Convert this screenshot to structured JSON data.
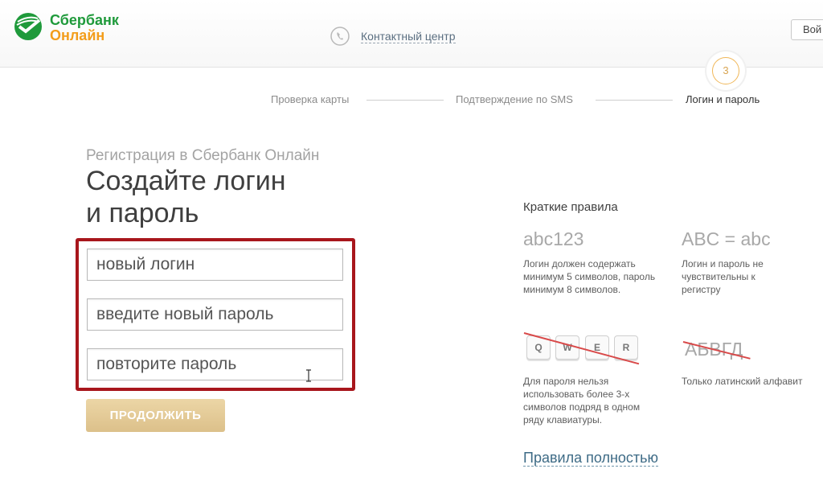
{
  "brand": {
    "line1": "Сбербанк",
    "line2": "Онлайн",
    "logo_icon": "sberbank-logo-icon"
  },
  "header": {
    "contact_center": "Контактный центр",
    "login_button": "Вой"
  },
  "steps": {
    "items": [
      "Проверка карты",
      "Подтверждение по SMS",
      "Логин и пароль"
    ],
    "current_number": "3"
  },
  "page": {
    "subtitle": "Регистрация в Сбербанк Онлайн",
    "title_line1": "Создайте логин",
    "title_line2": "и пароль"
  },
  "form": {
    "login_placeholder": "новый логин",
    "password_placeholder": "введите новый пароль",
    "repeat_placeholder": "повторите пароль",
    "continue_label": "ПРОДОЛЖИТЬ"
  },
  "rules": {
    "title": "Краткие правила",
    "rule1": {
      "big": "abc123",
      "text": "Логин должен содержать минимум 5 символов, пароль минимум 8 символов."
    },
    "rule2": {
      "big": "ABC = abc",
      "text": "Логин и пароль не чувствительны к регистру"
    },
    "rule3": {
      "keys": [
        "Q",
        "W",
        "E",
        "R"
      ],
      "text": "Для пароля нельзя использовать более 3-х символов подряд в одном ряду клавиатуры."
    },
    "rule4": {
      "big": "АБВГД",
      "text": "Только латинский алфавит"
    },
    "full_link": "Правила полностью"
  },
  "colors": {
    "brand_green": "#1f9a3b",
    "brand_orange": "#f39d1b",
    "highlight_red": "#a8161c",
    "button_gold": "#dcc08a",
    "link_blue": "#3e6b86"
  }
}
